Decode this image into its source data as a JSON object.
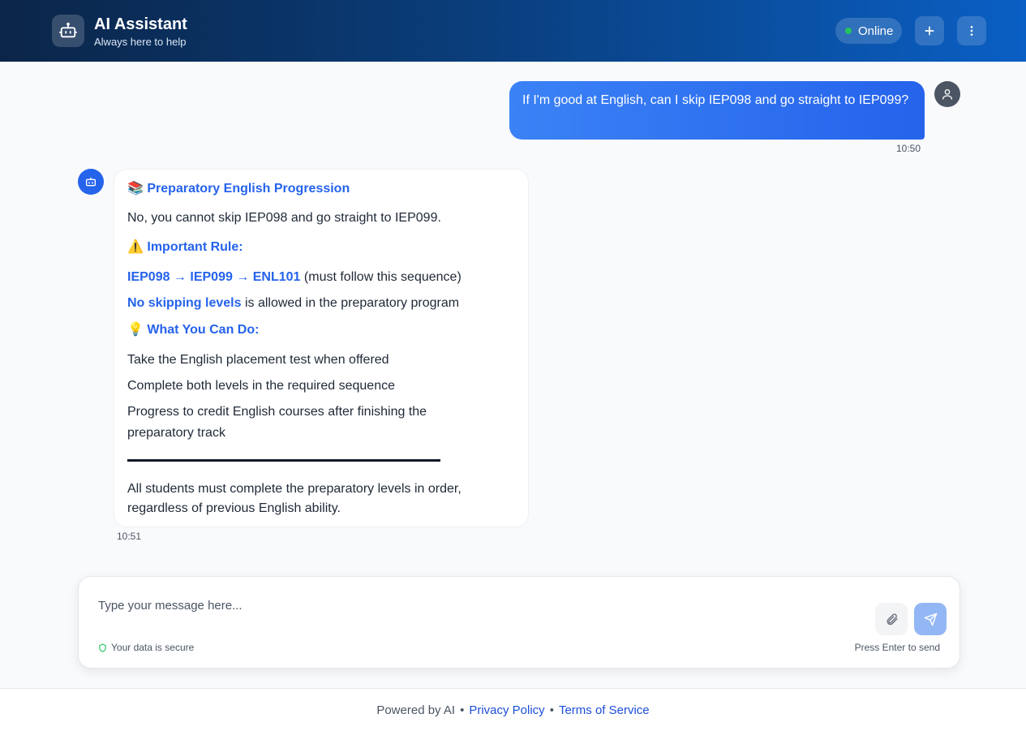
{
  "header": {
    "title": "AI Assistant",
    "subtitle": "Always here to help",
    "status": "Online",
    "icons": {
      "logo": "robot-icon",
      "new_chat": "plus-icon",
      "menu": "more-vertical-icon"
    }
  },
  "messages": {
    "user": {
      "text": "If I'm good at English, can I skip IEP098 and go straight to IEP099?",
      "time": "10:50",
      "avatar_icon": "user-icon"
    },
    "assistant": {
      "avatar_icon": "robot-icon",
      "heading_emoji": "📚",
      "heading": "Preparatory English Progression",
      "answer": "No, you cannot skip IEP098 and go straight to IEP099.",
      "rule_emoji": "⚠️",
      "rule_heading": "Important Rule:",
      "sequence": "IEP098 → IEP099 → ENL101",
      "sequence_note": "(must follow this sequence)",
      "no_skip_bold": "No skipping levels",
      "no_skip_rest": "is allowed in the preparatory program",
      "tips_emoji": "💡",
      "tips_heading": "What You Can Do:",
      "tip_1": "Take the English placement test when offered",
      "tip_2": "Complete both levels in the required sequence",
      "tip_3_line1": "Progress to credit English courses after finishing the",
      "tip_3_line2": "preparatory track",
      "closing_line1": "All students must complete the preparatory levels in order,",
      "closing_line2": "regardless of previous English ability.",
      "time": "10:51"
    }
  },
  "composer": {
    "placeholder": "Type your message here...",
    "secure_text": "Your data is secure",
    "hint": "Press Enter to send",
    "icons": {
      "attach": "paperclip-icon",
      "send": "send-icon",
      "secure": "shield-icon"
    }
  },
  "footer": {
    "powered": "Powered by AI",
    "bullet": "•",
    "privacy": "Privacy Policy",
    "terms": "Terms of Service"
  },
  "colors": {
    "accent": "#2563eb",
    "header_start": "#0b2548",
    "header_end": "#0a5fc4",
    "online": "#22c55e"
  }
}
